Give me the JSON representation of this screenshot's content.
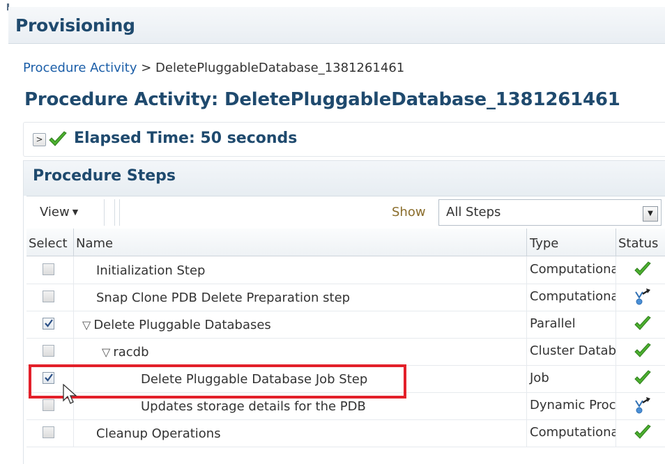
{
  "header": {
    "title": "Provisioning"
  },
  "breadcrumb": {
    "link": "Procedure Activity",
    "separator": ">",
    "current": "DeletePluggableDatabase_1381261461"
  },
  "activity": {
    "title": "Procedure Activity: DeletePluggableDatabase_1381261461"
  },
  "elapsed": {
    "expand_glyph": ">",
    "text": "Elapsed Time: 50 seconds",
    "icon": "check-icon"
  },
  "steps": {
    "title": "Procedure Steps",
    "toolbar": {
      "view_label": "View",
      "view_arrow": "▼",
      "show_label": "Show",
      "show_value": "All Steps",
      "show_button": "▼"
    },
    "columns": {
      "select": "Select",
      "name": "Name",
      "type": "Type",
      "status": "Status"
    },
    "rows": [
      {
        "name": "Initialization Step",
        "type": "Computational",
        "checked": false,
        "tree": "",
        "status": "succeeded"
      },
      {
        "name": "Snap Clone PDB Delete Preparation step",
        "type": "Computational",
        "checked": false,
        "tree": "",
        "status": "skipped"
      },
      {
        "name": "Delete Pluggable Databases",
        "type": "Parallel",
        "checked": true,
        "tree": "▽",
        "status": "succeeded"
      },
      {
        "name": "racdb",
        "type": "Cluster Database",
        "checked": false,
        "tree": "▽",
        "status": "succeeded"
      },
      {
        "name": "Delete Pluggable Database Job Step",
        "type": "Job",
        "checked": true,
        "tree": "",
        "status": "succeeded"
      },
      {
        "name": "Updates storage details for the PDB",
        "type": "Dynamic Procedure",
        "checked": false,
        "tree": "",
        "status": "skipped"
      },
      {
        "name": "Cleanup Operations",
        "type": "Computational",
        "checked": false,
        "tree": "",
        "status": "succeeded"
      }
    ]
  },
  "colors": {
    "title": "#1f4a6e",
    "link": "#1b5ea8",
    "success": "#3c9a2a",
    "skipped": "#2f6fb3",
    "highlight": "#e3202a"
  }
}
